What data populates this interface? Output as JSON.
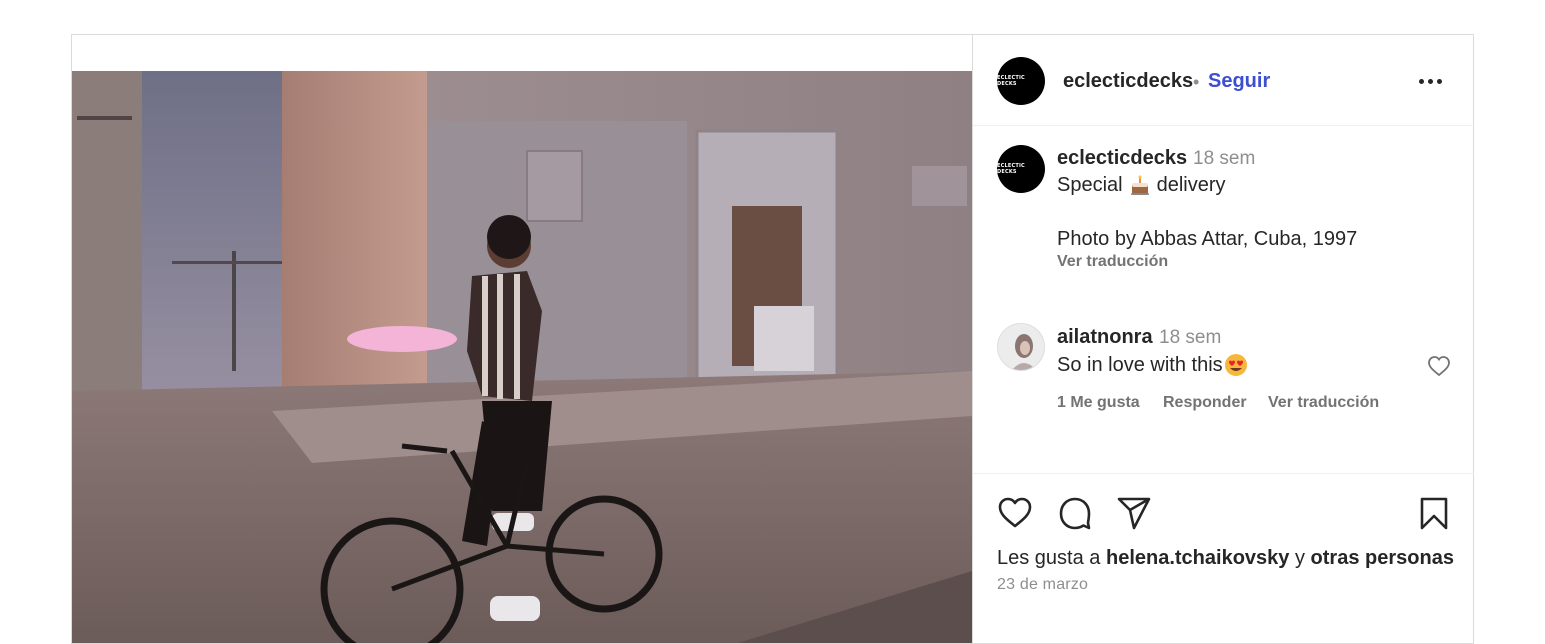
{
  "post": {
    "author": "eclecticdecks",
    "avatar_text": "ECLECTIC DECKS",
    "separator": "•",
    "follow_label": "Seguir",
    "caption": {
      "username": "eclecticdecks",
      "time": "18 sem",
      "text_before": "Special",
      "emoji": "cake-emoji",
      "text_after": "delivery",
      "credit": "Photo by Abbas Attar, Cuba, 1997",
      "translate_label": "Ver traducción"
    },
    "comment": {
      "username": "ailatnonra",
      "time": "18 sem",
      "text": "So in love with this",
      "emoji": "heart-eyes-emoji",
      "likes_label": "1 Me gusta",
      "reply_label": "Responder",
      "translate_label": "Ver traducción"
    },
    "likes": {
      "prefix": "Les gusta a",
      "user": "helena.tchaikovsky",
      "joiner": "y",
      "others": "otras personas"
    },
    "date": "23 de marzo"
  },
  "colors": {
    "follow": "#3d4fd1",
    "muted": "#8e8e8e",
    "text": "#262626",
    "border": "#dbdbdb"
  }
}
